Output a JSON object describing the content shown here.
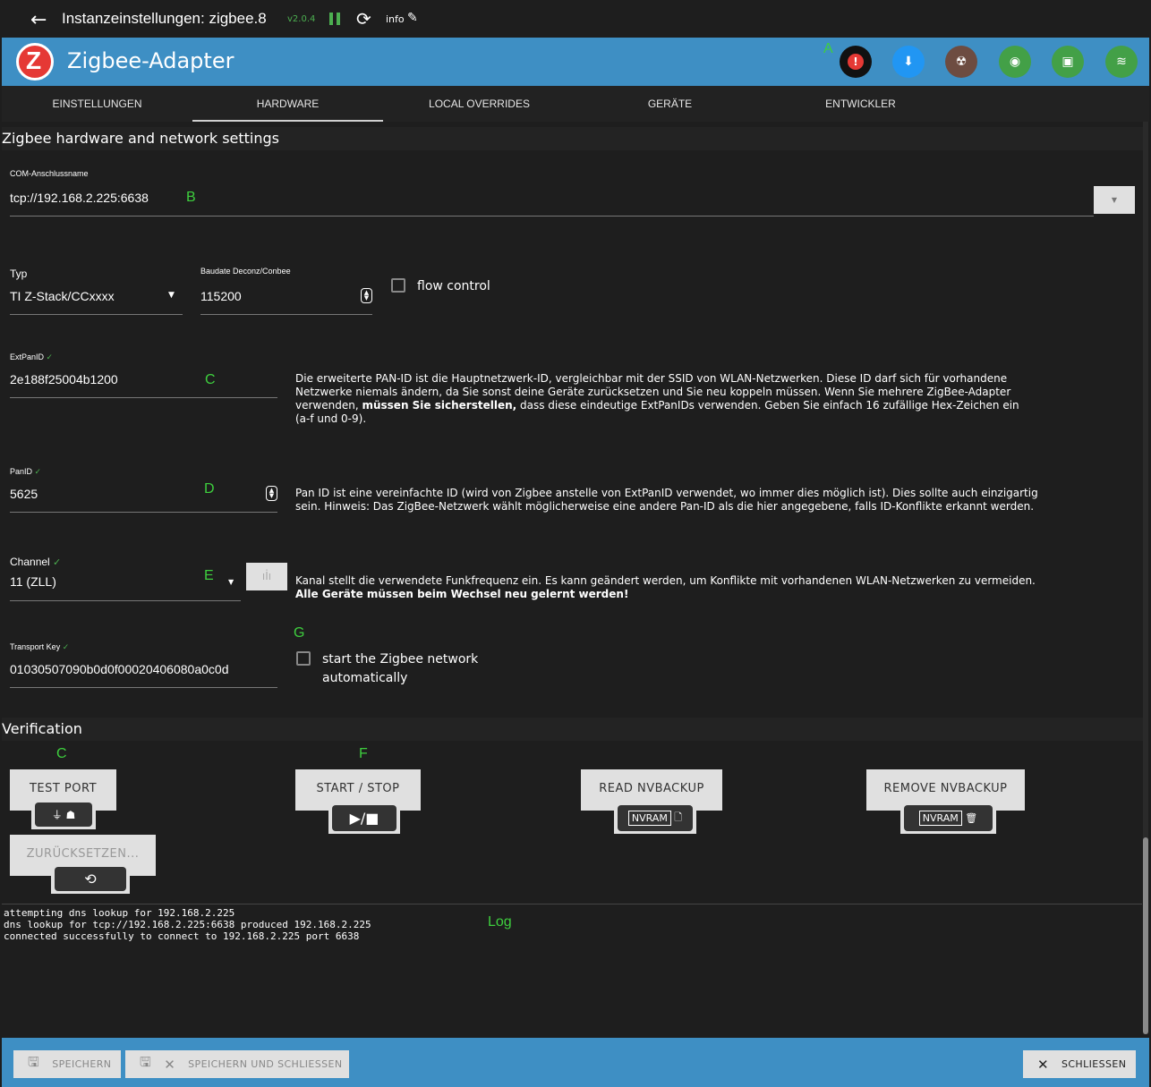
{
  "topbar": {
    "title": "Instanzeinstellungen: zigbee.8",
    "version": "v2.0.4",
    "info_label": "info"
  },
  "header": {
    "adapter_name": "Zigbee-Adapter",
    "logo_letter": "Z",
    "marker_a": "A",
    "icons": [
      {
        "name": "error-icon",
        "color": "#111111",
        "glyph": "!"
      },
      {
        "name": "download-icon",
        "color": "#2196f3",
        "glyph": "⬇"
      },
      {
        "name": "radioactive-icon",
        "color": "#6d4c41",
        "glyph": "☢"
      },
      {
        "name": "signal-icon",
        "color": "#43a047",
        "glyph": "◉"
      },
      {
        "name": "chip-icon",
        "color": "#43a047",
        "glyph": "▣"
      },
      {
        "name": "zigbee-icon",
        "color": "#43a047",
        "glyph": "≋"
      }
    ]
  },
  "tabs": [
    "EINSTELLUNGEN",
    "HARDWARE",
    "LOCAL OVERRIDES",
    "GERÄTE",
    "ENTWICKLER"
  ],
  "hardware": {
    "section_title": "Zigbee hardware and network settings",
    "com_label": "COM-Anschlussname",
    "com_value": "tcp://192.168.2.225:6638",
    "marker_b": "B",
    "type_label": "Typ",
    "type_value": "TI Z-Stack/CCxxxx",
    "baud_label": "Baudate Deconz/Conbee",
    "baud_value": "115200",
    "flow_control_label": "flow control",
    "extpanid_label": "ExtPanID",
    "extpanid_value": "2e188f25004b1200",
    "marker_c": "C",
    "extpanid_desc_1": "Die erweiterte PAN-ID ist die Hauptnetzwerk-ID, vergleichbar mit der SSID von WLAN-Netzwerken. Diese ID darf sich für vorhandene Netzwerke niemals ändern, da Sie sonst deine Geräte zurücksetzen und Sie neu koppeln müssen. Wenn Sie mehrere ZigBee-Adapter verwenden, ",
    "extpanid_desc_bold": "müssen Sie sicherstellen,",
    "extpanid_desc_2": " dass diese eindeutige ExtPanIDs verwenden. Geben Sie einfach 16 zufällige Hex-Zeichen ein (a-f und 0-9).",
    "panid_label": "PanID",
    "panid_value": "5625",
    "marker_d": "D",
    "panid_desc": "Pan ID ist eine vereinfachte ID (wird von Zigbee anstelle von ExtPanID verwendet, wo immer dies möglich ist). Dies sollte auch einzigartig sein. Hinweis: Das ZigBee-Netzwerk wählt möglicherweise eine andere Pan-ID als die hier angegebene, falls ID-Konflikte erkannt werden.",
    "channel_label": "Channel",
    "channel_value": "11 (ZLL)",
    "marker_e": "E",
    "channel_desc": "Kanal stellt die verwendete Funkfrequenz ein. Es kann geändert werden, um Konflikte mit vorhandenen WLAN-Netzwerken zu vermeiden. ",
    "channel_desc_bold": "Alle Geräte müssen beim Wechsel neu gelernt werden!",
    "transport_label": "Transport Key",
    "transport_value": "01030507090b0d0f00020406080a0c0d",
    "marker_g": "G",
    "autostart_label_1": "start the Zigbee network",
    "autostart_label_2": "automatically"
  },
  "verification": {
    "title": "Verification",
    "marker_c": "C",
    "marker_f": "F",
    "test_port": "TEST PORT",
    "start_stop": "START / STOP",
    "read_nvbackup": "READ NVBACKUP",
    "remove_nvbackup": "REMOVE NVBACKUP",
    "reset": "ZURÜCKSETZEN...",
    "nvram": "NVRAM"
  },
  "log": {
    "marker": "Log",
    "lines": [
      "attempting dns lookup for 192.168.2.225",
      "dns lookup for tcp://192.168.2.225:6638 produced 192.168.2.225",
      "connected successfully to connect to 192.168.2.225 port 6638"
    ]
  },
  "footer": {
    "save": "SPEICHERN",
    "save_close": "SPEICHERN UND SCHLIESSEN",
    "close": "SCHLIESSEN"
  }
}
